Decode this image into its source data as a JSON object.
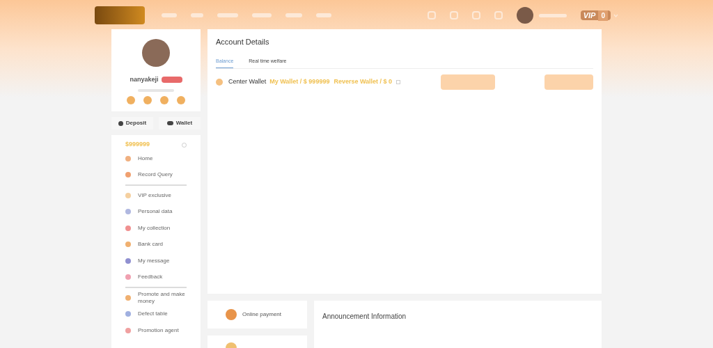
{
  "header": {
    "vip_label": "VIP",
    "vip_level": "0"
  },
  "profile": {
    "username": "nanyakeji"
  },
  "quick_actions": [
    {
      "label": "Deposit",
      "kind": "deposit"
    },
    {
      "label": "Wallet",
      "kind": "wallet"
    }
  ],
  "balance": "$999999",
  "menu": [
    {
      "label": "Home",
      "color": "#f0b080",
      "divider_after": false
    },
    {
      "label": "Record Query",
      "color": "#f0a070",
      "divider_after": true
    },
    {
      "label": "VIP exclusive",
      "color": "#f5d0a0",
      "divider_after": false
    },
    {
      "label": "Personal data",
      "color": "#b0b8e0",
      "divider_after": false
    },
    {
      "label": "My collection",
      "color": "#f09090",
      "divider_after": false
    },
    {
      "label": "Bank card",
      "color": "#f0b070",
      "divider_after": false
    },
    {
      "label": "My message",
      "color": "#9090d0",
      "divider_after": false
    },
    {
      "label": "Feedback",
      "color": "#f0a0b0",
      "divider_after": true
    },
    {
      "label": "Promote and make money",
      "color": "#f0b070",
      "divider_after": false
    },
    {
      "label": "Defect table",
      "color": "#a0b0e0",
      "divider_after": false
    },
    {
      "label": "Promotion agent",
      "color": "#f0a0a0",
      "divider_after": false
    }
  ],
  "account_details": {
    "title": "Account Details",
    "tabs": [
      {
        "label": "Balance",
        "selected": true
      },
      {
        "label": "Real time welfare",
        "selected": false
      }
    ],
    "wallet": {
      "name": "Center Wallet",
      "my_wallet": "My Wallet / $ 999999",
      "reverse_wallet": "Reverse Wallet / $ 0"
    }
  },
  "payment_cards": [
    {
      "label": "Online payment"
    }
  ],
  "announcement": {
    "title": "Announcement Information"
  }
}
